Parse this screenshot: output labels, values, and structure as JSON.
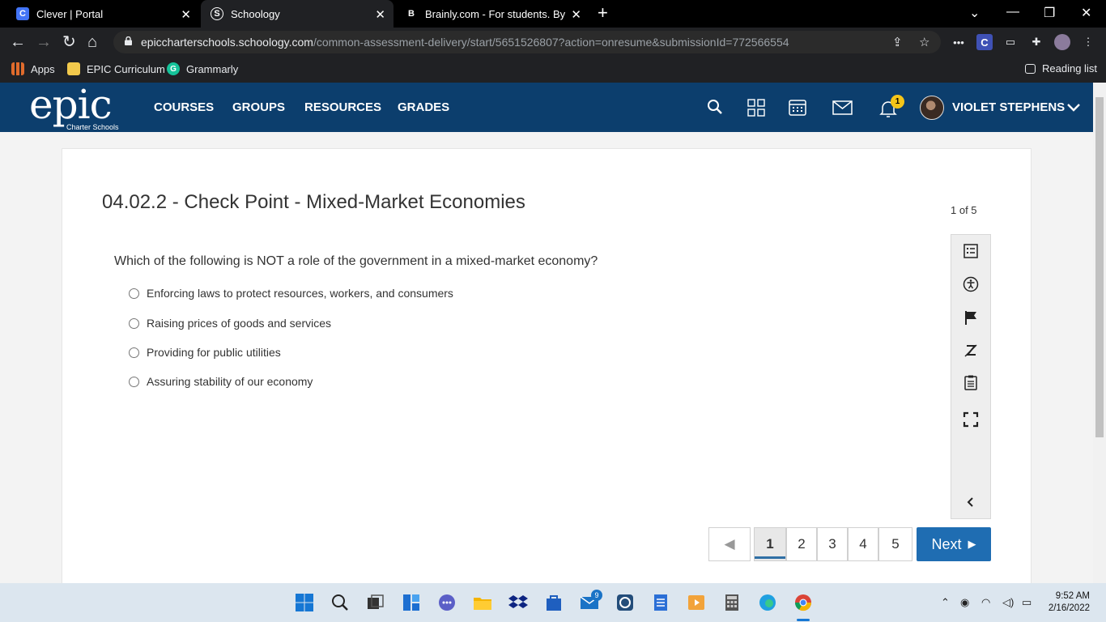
{
  "browser": {
    "tabs": [
      {
        "label": "Clever | Portal",
        "favicon": "C"
      },
      {
        "label": "Schoology",
        "favicon": "S"
      },
      {
        "label": "Brainly.com - For students. By stu",
        "favicon": "B"
      }
    ],
    "url_host": "epiccharterschools.schoology.com",
    "url_path": "/common-assessment-delivery/start/5651526807?action=onresume&submissionId=772566554",
    "bookmarks": [
      "Apps",
      "EPIC Curriculum",
      "Grammarly"
    ],
    "reading_list": "Reading list"
  },
  "header": {
    "logo_text": "epic",
    "logo_sub": "Charter Schools",
    "nav": [
      "COURSES",
      "GROUPS",
      "RESOURCES",
      "GRADES"
    ],
    "notification_count": "1",
    "user_name": "VIOLET STEPHENS"
  },
  "assessment": {
    "title": "04.02.2 - Check Point - Mixed-Market Economies",
    "counter": "1 of 5",
    "question": "Which of the following is NOT a role of the government in a mixed-market economy?",
    "choices": [
      "Enforcing laws to protect resources, workers, and consumers",
      "Raising prices of goods and services",
      "Providing for public utilities",
      "Assuring stability of our economy"
    ],
    "pages": [
      "1",
      "2",
      "3",
      "4",
      "5"
    ],
    "next_label": "Next"
  },
  "taskbar": {
    "mail_badge": "9",
    "time": "9:52 AM",
    "date": "2/16/2022"
  },
  "colors": {
    "header_bg": "#0c3e6d",
    "next_button": "#1f6db2",
    "badge": "#f5c518"
  }
}
